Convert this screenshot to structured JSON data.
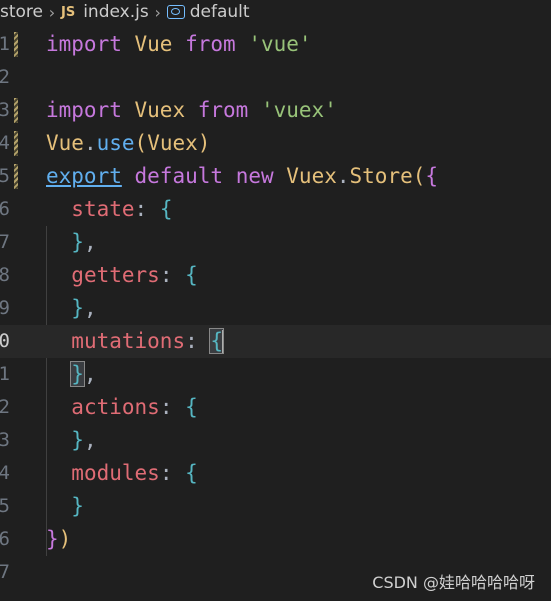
{
  "breadcrumb": {
    "folder": "store",
    "file_badge": "JS",
    "file": "index.js",
    "symbol": "default"
  },
  "gutter": [
    "1",
    "2",
    "3",
    "4",
    "5",
    "6",
    "7",
    "8",
    "9",
    "0",
    "1",
    "2",
    "3",
    "4",
    "5",
    "6",
    "7"
  ],
  "code": {
    "l1": {
      "kw": "import",
      "name": "Vue",
      "from": "from",
      "src": "'vue'"
    },
    "l3": {
      "kw": "import",
      "name": "Vuex",
      "from": "from",
      "src": "'vuex'"
    },
    "l4": {
      "obj": "Vue",
      "dot": ".",
      "method": "use",
      "open": "(",
      "arg": "Vuex",
      "close": ")"
    },
    "l5": {
      "export": "export",
      "default": "default",
      "new": "new",
      "cls": "Vuex",
      "dot": ".",
      "ctor": "Store",
      "paren": "(",
      "brace": "{"
    },
    "state": {
      "key": "state",
      "colon": ": ",
      "brace": "{"
    },
    "getters": {
      "key": "getters",
      "colon": ": ",
      "brace": "{"
    },
    "mutations": {
      "key": "mutations",
      "colon": ": ",
      "brace": "{"
    },
    "actions": {
      "key": "actions",
      "colon": ": ",
      "brace": "{"
    },
    "modules": {
      "key": "modules",
      "colon": ": ",
      "brace": "{"
    },
    "close_brace": "}",
    "comma": ",",
    "last_brace": "}",
    "last_paren": ")"
  },
  "watermark": "CSDN @娃哈哈哈哈呀",
  "colors": {
    "background": "#1f1f1f",
    "keyword": "#c678dd",
    "class": "#e5c07b",
    "string": "#98c379",
    "function": "#61afef",
    "property": "#e06c75",
    "inner_brace": "#56b6c2"
  },
  "icons": [
    "chevron-right-icon",
    "js-file-icon",
    "symbol-field-icon"
  ]
}
